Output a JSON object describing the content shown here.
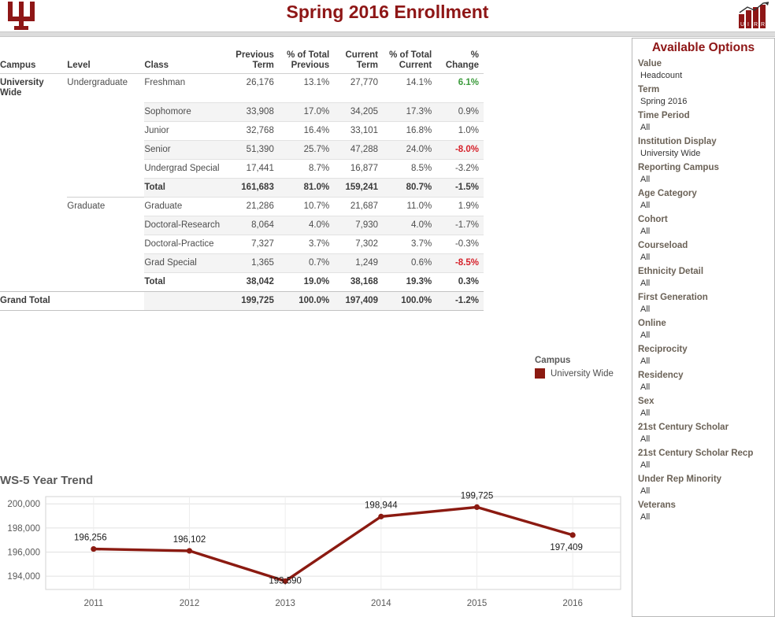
{
  "header": {
    "title": "Spring 2016 Enrollment",
    "left_logo": "iu-trident-logo",
    "right_logo": "uirr-bar-chart-logo",
    "brand_color": "#8e1616"
  },
  "table": {
    "columns": [
      "Campus",
      "Level",
      "Class",
      "Previous\nTerm",
      "% of Total\nPrevious",
      "Current\nTerm",
      "% of Total\nCurrent",
      "% Change"
    ],
    "rows": [
      {
        "campus": "University Wide",
        "level": "Undergraduate",
        "class": "Freshman",
        "prev": "26,176",
        "prev_pct": "13.1%",
        "curr": "27,770",
        "curr_pct": "14.1%",
        "change": "6.1%",
        "change_state": "pos",
        "shade": false
      },
      {
        "campus": "",
        "level": "",
        "class": "Sophomore",
        "prev": "33,908",
        "prev_pct": "17.0%",
        "curr": "34,205",
        "curr_pct": "17.3%",
        "change": "0.9%",
        "change_state": "neutral",
        "shade": true
      },
      {
        "campus": "",
        "level": "",
        "class": "Junior",
        "prev": "32,768",
        "prev_pct": "16.4%",
        "curr": "33,101",
        "curr_pct": "16.8%",
        "change": "1.0%",
        "change_state": "neutral",
        "shade": false
      },
      {
        "campus": "",
        "level": "",
        "class": "Senior",
        "prev": "51,390",
        "prev_pct": "25.7%",
        "curr": "47,288",
        "curr_pct": "24.0%",
        "change": "-8.0%",
        "change_state": "neg",
        "shade": true
      },
      {
        "campus": "",
        "level": "",
        "class": "Undergrad Special",
        "prev": "17,441",
        "prev_pct": "8.7%",
        "curr": "16,877",
        "curr_pct": "8.5%",
        "change": "-3.2%",
        "change_state": "neutral",
        "shade": false
      },
      {
        "campus": "",
        "level": "",
        "class": "Total",
        "prev": "161,683",
        "prev_pct": "81.0%",
        "curr": "159,241",
        "curr_pct": "80.7%",
        "change": "-1.5%",
        "change_state": "neutral",
        "shade": true,
        "total": true
      },
      {
        "campus": "",
        "level": "Graduate",
        "class": "Graduate",
        "prev": "21,286",
        "prev_pct": "10.7%",
        "curr": "21,687",
        "curr_pct": "11.0%",
        "change": "1.9%",
        "change_state": "neutral",
        "shade": false,
        "level_sep": true
      },
      {
        "campus": "",
        "level": "",
        "class": "Doctoral-Research",
        "prev": "8,064",
        "prev_pct": "4.0%",
        "curr": "7,930",
        "curr_pct": "4.0%",
        "change": "-1.7%",
        "change_state": "neutral",
        "shade": true
      },
      {
        "campus": "",
        "level": "",
        "class": "Doctoral-Practice",
        "prev": "7,327",
        "prev_pct": "3.7%",
        "curr": "7,302",
        "curr_pct": "3.7%",
        "change": "-0.3%",
        "change_state": "neutral",
        "shade": false
      },
      {
        "campus": "",
        "level": "",
        "class": "Grad Special",
        "prev": "1,365",
        "prev_pct": "0.7%",
        "curr": "1,249",
        "curr_pct": "0.6%",
        "change": "-8.5%",
        "change_state": "neg",
        "shade": true
      },
      {
        "campus": "",
        "level": "",
        "class": "Total",
        "prev": "38,042",
        "prev_pct": "19.0%",
        "curr": "38,168",
        "curr_pct": "19.3%",
        "change": "0.3%",
        "change_state": "neutral",
        "shade": false,
        "total": true
      }
    ],
    "grand_total": {
      "label": "Grand Total",
      "prev": "199,725",
      "prev_pct": "100.0%",
      "curr": "197,409",
      "curr_pct": "100.0%",
      "change": "-1.2%",
      "change_state": "neutral"
    },
    "positive_color": "#3c9b3c",
    "negative_color": "#d6212a"
  },
  "legend": {
    "title": "Campus",
    "entries": [
      {
        "label": "University Wide",
        "color": "#8b1a11"
      }
    ]
  },
  "chart_data": {
    "type": "line",
    "title": "WS-5 Year Trend",
    "xlabel": "",
    "ylabel": "",
    "x": [
      "2011",
      "2012",
      "2013",
      "2014",
      "2015",
      "2016"
    ],
    "categories": [
      "2011",
      "2012",
      "2013",
      "2014",
      "2015",
      "2016"
    ],
    "values": [
      196256,
      196102,
      193590,
      198944,
      199725,
      197409
    ],
    "point_labels": [
      "196,256",
      "196,102",
      "193,590",
      "198,944",
      "199,725",
      "197,409"
    ],
    "series": [
      {
        "name": "University Wide",
        "color": "#8b1a11",
        "values": [
          196256,
          196102,
          193590,
          198944,
          199725,
          197409
        ]
      }
    ],
    "yticks": [
      194000,
      196000,
      198000,
      200000
    ],
    "ytick_labels": [
      "194,000",
      "196,000",
      "198,000",
      "200,000"
    ],
    "ylim": [
      192900,
      200600
    ],
    "grid": true,
    "legend_position": "above-right"
  },
  "options": {
    "title": "Available Options",
    "items": [
      {
        "label": "Value",
        "value": "Headcount"
      },
      {
        "label": "Term",
        "value": "Spring 2016"
      },
      {
        "label": "Time Period",
        "value": "All"
      },
      {
        "label": "Institution Display",
        "value": "University Wide"
      },
      {
        "label": "Reporting Campus",
        "value": "All"
      },
      {
        "label": "Age Category",
        "value": "All"
      },
      {
        "label": "Cohort",
        "value": "All"
      },
      {
        "label": "Courseload",
        "value": "All"
      },
      {
        "label": "Ethnicity Detail",
        "value": "All"
      },
      {
        "label": "First Generation",
        "value": "All"
      },
      {
        "label": "Online",
        "value": "All"
      },
      {
        "label": "Reciprocity",
        "value": "All"
      },
      {
        "label": "Residency",
        "value": "All"
      },
      {
        "label": "Sex",
        "value": "All"
      },
      {
        "label": "21st Century Scholar",
        "value": "All"
      },
      {
        "label": "21st Century Scholar Recp",
        "value": "All"
      },
      {
        "label": "Under Rep Minority",
        "value": "All"
      },
      {
        "label": "Veterans",
        "value": "All"
      }
    ]
  }
}
